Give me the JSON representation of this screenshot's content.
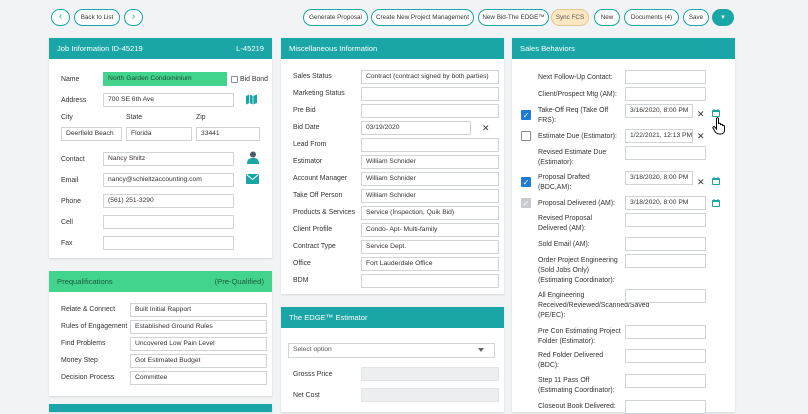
{
  "toolbar": {
    "back_label": "Back to List",
    "buttons": [
      "Generate Proposal",
      "Create New Project Management",
      "New Bid-The EDGE™",
      "Sync FCS",
      "New",
      "Documents (4)",
      "Save"
    ],
    "prev_glyph": "‹",
    "next_glyph": "›",
    "menu_glyph": "▾"
  },
  "job": {
    "title": "Job Information ID-45219",
    "code": "L-45219",
    "name_label": "Name",
    "name_value": "North Garden Condominium",
    "bid_bond_label": "Bid Bond",
    "address_label": "Address",
    "address_value": "700 SE 6th Ave",
    "city_label": "City",
    "state_label": "State",
    "zip_label": "Zip",
    "city_value": "Deerfield Beach",
    "state_value": "Florida",
    "zip_value": "33441",
    "contact_label": "Contact",
    "contact_value": "Nancy Shiltz",
    "email_label": "Email",
    "email_value": "nancy@schieltzaccounting.com",
    "phone_label": "Phone",
    "phone_value": "(561) 251-3290",
    "cell_label": "Cell",
    "cell_value": "",
    "fax_label": "Fax",
    "fax_value": ""
  },
  "prequal": {
    "title": "Prequalifications",
    "status": "(Pre-Qualified)",
    "rows": [
      {
        "label": "Relate & Connect",
        "value": "Built Initial Rapport"
      },
      {
        "label": "Rules of Engagement",
        "value": "Established Ground Rules"
      },
      {
        "label": "Find Problems",
        "value": "Uncovered Low Pain Level"
      },
      {
        "label": "Money Step",
        "value": "Got Estimated Budget"
      },
      {
        "label": "Decision Process",
        "value": "Committee"
      }
    ]
  },
  "misc": {
    "title": "Miscellaneous Information",
    "rows": [
      {
        "label": "Sales Status",
        "value": "Contract (contract signed by both parties)"
      },
      {
        "label": "Marketing Status",
        "value": ""
      },
      {
        "label": "Pre Bid",
        "value": ""
      },
      {
        "label": "Bid Date",
        "value": "03/19/2020"
      },
      {
        "label": "Lead From",
        "value": ""
      },
      {
        "label": "Estimator",
        "value": "William Schnider"
      },
      {
        "label": "Account Manager",
        "value": "William Schnider"
      },
      {
        "label": "Take Off Person",
        "value": "William Schnider"
      },
      {
        "label": "Products & Services",
        "value": "Service (Inspection, Quik Bid)"
      },
      {
        "label": "Client Profile",
        "value": "Condo- Apt- Multi-family"
      },
      {
        "label": "Contract Type",
        "value": "Service Dept."
      },
      {
        "label": "Office",
        "value": "Fort Lauderdale Office"
      },
      {
        "label": "BDM",
        "value": ""
      }
    ]
  },
  "edge": {
    "title": "The EDGE™ Estimator",
    "select_placeholder": "Select option",
    "gross_label": "Grosss Price",
    "net_label": "Net Cost"
  },
  "sales": {
    "title": "Sales Behaviors",
    "rows": [
      {
        "label": "Next Follow-Up Contact:",
        "value": ""
      },
      {
        "label": "Client/Prospect Mtg (AM):",
        "value": ""
      },
      {
        "label": "Take-Off Req (Take Off FRS):",
        "value": "3/16/2020, 8:00 PM"
      },
      {
        "label": "Estimate Due (Estimator):",
        "value": "1/22/2021, 12:13 PM"
      },
      {
        "label": "Revised Estimate Due (Estimator):",
        "value": ""
      },
      {
        "label": "Proposal Drafted (BDC,AM):",
        "value": "3/18/2020, 8:00 PM"
      },
      {
        "label": "Proposal Delivered (AM):",
        "value": "3/18/2020, 8:00 PM"
      },
      {
        "label": "Revised Proposal Delivered (AM):",
        "value": ""
      },
      {
        "label": "Sold Email (AM):",
        "value": ""
      },
      {
        "label": "Order Project Engineering (Sold Jobs Only) (Estimating Coordinator):",
        "value": ""
      },
      {
        "label": "All Engineering Received/Reviewed/Scanned/Saved (PE/EC):",
        "value": ""
      },
      {
        "label": "Pre Con Estimating Project Folder (Estimator):",
        "value": ""
      },
      {
        "label": "Red Folder Delivered (BDC):",
        "value": ""
      },
      {
        "label": "Step 11 Pass Off (Estimating Coordinator):",
        "value": ""
      },
      {
        "label": "Closeout Book Delivered:",
        "value": ""
      }
    ],
    "clear_glyph": "✕",
    "check_glyph": "✓"
  }
}
